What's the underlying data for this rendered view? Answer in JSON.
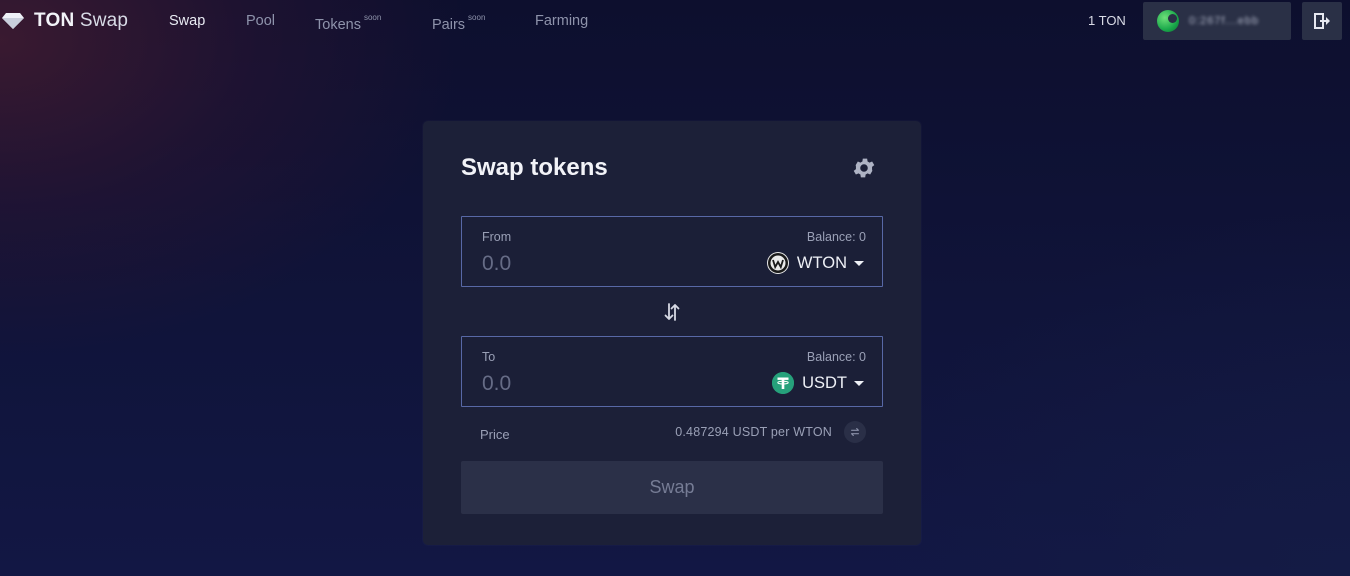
{
  "nav": {
    "brand_bold": "TON",
    "brand_light": "Swap",
    "links": [
      {
        "label": "Swap",
        "badge": ""
      },
      {
        "label": "Pool",
        "badge": ""
      },
      {
        "label": "Tokens",
        "badge": "soon"
      },
      {
        "label": "Pairs",
        "badge": "soon"
      },
      {
        "label": "Farming",
        "badge": ""
      }
    ],
    "ton_balance": "1 TON",
    "wallet_address": "0:267f...ebb"
  },
  "card": {
    "title": "Swap tokens",
    "from": {
      "label": "From",
      "balance": "Balance: 0",
      "placeholder": "0.0",
      "token": "WTON",
      "token_icon": "wton-logo-icon"
    },
    "to": {
      "label": "To",
      "balance": "Balance: 0",
      "placeholder": "0.0",
      "token": "USDT",
      "token_icon": "tether-logo-icon"
    },
    "price_label": "Price",
    "price_value": "0.487294 USDT per WTON",
    "swap_button": "Swap"
  },
  "colors": {
    "accent_border": "#5868a6",
    "card_bg": "#1c2038",
    "usdt_green": "#26a17b",
    "button_bg": "#2b3048"
  }
}
